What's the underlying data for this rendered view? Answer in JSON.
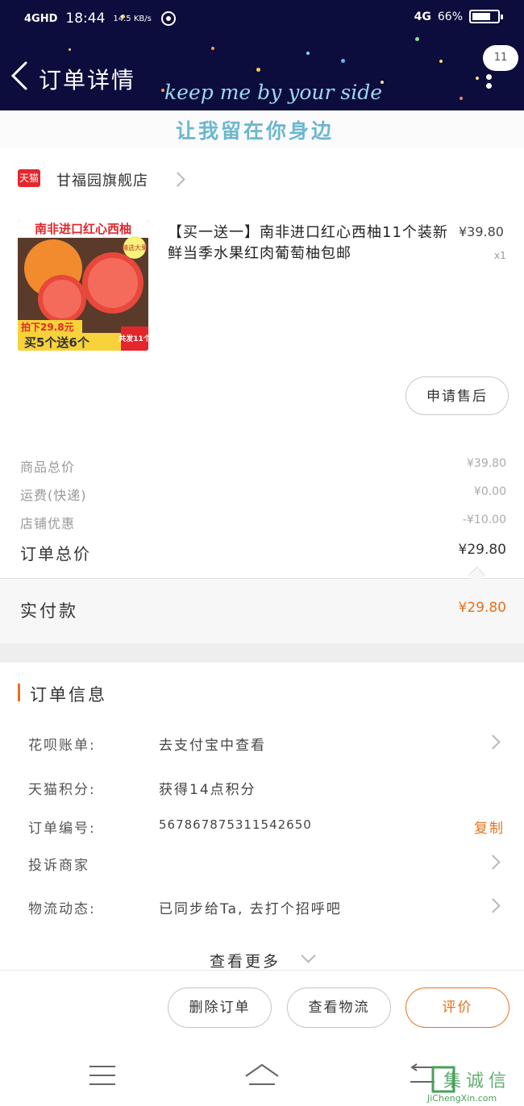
{
  "status_bar": {
    "network": "4GHD",
    "time": "18:44",
    "speed": "14.5 KB/s",
    "signal_right": "4G",
    "battery": "66%"
  },
  "header": {
    "title": "订单详情",
    "deco_en": "keep me by your side",
    "more_badge": "11"
  },
  "deco_band": {
    "text": "让我留在你身边"
  },
  "store": {
    "badge": "天猫",
    "name": "甘福园旗舰店"
  },
  "product": {
    "title": "【买一送一】南非进口红心西柚11个装新鲜当季水果红肉葡萄柚包邮",
    "price": "¥39.80",
    "qty": "x1",
    "image": {
      "banner": "南非进口红心西柚",
      "tag": "精选大果",
      "promo_price": "拍下29.8元",
      "promo": "买5个送6个",
      "total_tag": "共发11个"
    },
    "aftersale_button": "申请售后"
  },
  "summary": {
    "items": [
      {
        "label": "商品总价",
        "value": "¥39.80"
      },
      {
        "label": "运费(快递)",
        "value": "¥0.00"
      },
      {
        "label": "店铺优惠",
        "value": "-¥10.00"
      }
    ],
    "total_label": "订单总价",
    "total_value": "¥29.80",
    "paid_label": "实付款",
    "paid_value": "¥29.80"
  },
  "order_info": {
    "title": "订单信息",
    "rows": [
      {
        "label": "花呗账单:",
        "value": "去支付宝中查看"
      },
      {
        "label": "天猫积分:",
        "value": "获得14点积分"
      },
      {
        "label": "订单编号:",
        "value": "567867875311542650"
      },
      {
        "label": "投诉商家",
        "value": ""
      },
      {
        "label": "物流动态:",
        "value": "已同步给Ta, 去打个招呼吧"
      }
    ],
    "copy_label": "复制",
    "view_more": "查看更多"
  },
  "actions": {
    "delete": "删除订单",
    "logistics": "查看物流",
    "review": "评价"
  },
  "watermark": {
    "text": "JiChengXin.com",
    "brand": "集诚信"
  },
  "colors": {
    "accent": "#e8711b",
    "header_bg": "#0c0d3c",
    "tmall_red": "#e4262c"
  },
  "icons": [
    "back-arrow-icon",
    "more-dots-icon",
    "chevron-right-icon",
    "chevron-down-icon",
    "menu-icon",
    "home-icon",
    "return-icon"
  ]
}
